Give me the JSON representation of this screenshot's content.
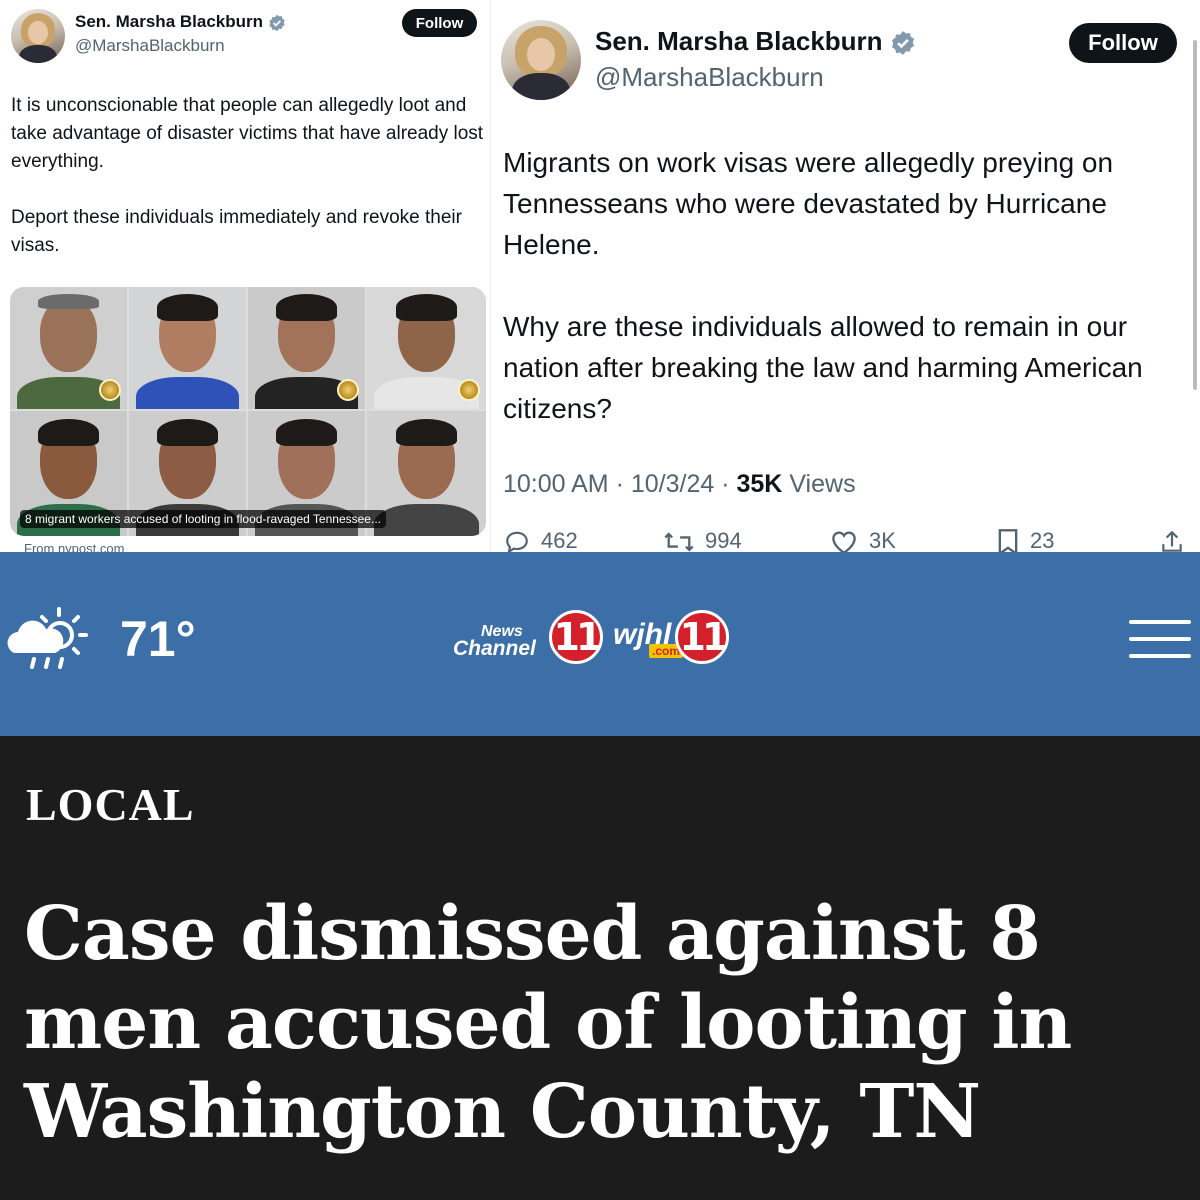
{
  "tweet_small": {
    "name": "Sen. Marsha Blackburn",
    "handle": "@MarshaBlackburn",
    "follow_label": "Follow",
    "paragraph_1": "It is unconscionable that people can allegedly loot and take advantage of disaster victims that have already lost everything.",
    "paragraph_2": "Deport these individuals immediately and revoke their visas.",
    "card_caption": "8 migrant workers accused of looting in flood-ravaged Tennessee...",
    "card_source": "From nypost.com"
  },
  "tweet_large": {
    "name": "Sen. Marsha Blackburn",
    "handle": "@MarshaBlackburn",
    "follow_label": "Follow",
    "paragraph_1": "Migrants on work visas were allegedly preying on Tennesseans who were devastated by Hurricane Helene.",
    "paragraph_2": "Why are these individuals allowed to remain in our nation after breaking the law and harming American citizens?",
    "time": "10:00 AM",
    "date": "10/3/24",
    "views_count": "35K",
    "views_label": "Views",
    "replies": "462",
    "reposts": "994",
    "likes": "3K",
    "bookmarks": "23"
  },
  "site_header": {
    "temperature": "71°",
    "logo_news": "News",
    "logo_channel": "Channel",
    "logo_number": "11",
    "logo_wjhl": "wjhl",
    "logo_dotcom": ".com"
  },
  "article": {
    "section": "LOCAL",
    "headline": "Case dismissed against 8 men accused of looting in Washington County, TN"
  },
  "colors": {
    "header_blue": "#3c6fa8",
    "article_bg": "#1c1c1c",
    "logo_red": "#d4202a",
    "verified_blue": "#829aab"
  }
}
